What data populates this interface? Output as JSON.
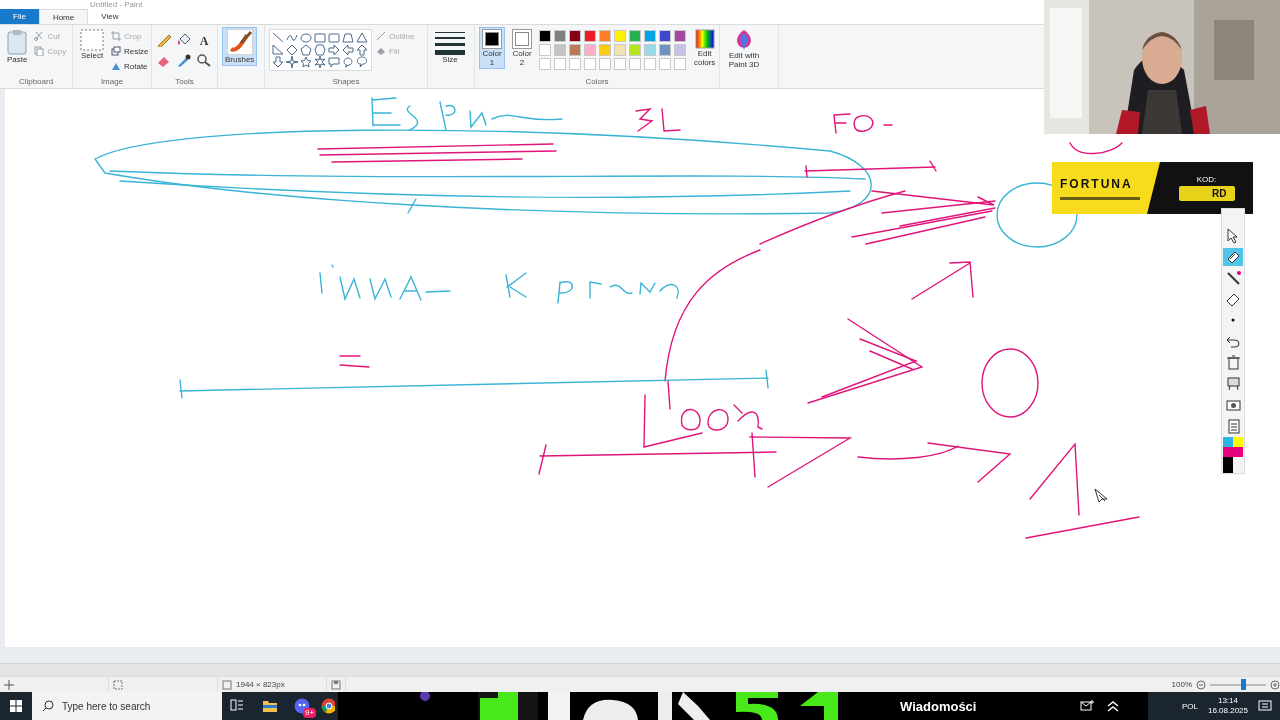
{
  "title_bar": {
    "title": "Untitled - Paint"
  },
  "tabs": [
    {
      "label": "File",
      "kind": "file",
      "selected": false
    },
    {
      "label": "Home",
      "kind": "tab",
      "selected": true
    },
    {
      "label": "View",
      "kind": "tab",
      "selected": false
    }
  ],
  "ribbon": {
    "clipboard": {
      "label": "Clipboard",
      "paste": "Paste",
      "cut": {
        "label": "Cut",
        "disabled": true
      },
      "copy": {
        "label": "Copy",
        "disabled": true
      }
    },
    "image": {
      "label": "Image",
      "select": "Select",
      "crop": {
        "label": "Crop",
        "disabled": true
      },
      "resize": {
        "label": "Resize",
        "disabled": false
      },
      "rotate": {
        "label": "Rotate",
        "disabled": false
      }
    },
    "tools": {
      "label": "Tools",
      "text_tool": "A"
    },
    "brushes": {
      "label": "Brushes",
      "selected": true
    },
    "shapes": {
      "label": "Shapes",
      "outline": {
        "label": "Outline",
        "disabled": true
      },
      "fill": {
        "label": "Fill",
        "disabled": true
      }
    },
    "size": {
      "label": "Size"
    },
    "colors": {
      "label": "Colors",
      "color1": {
        "label": "Color 1",
        "color": "#000000",
        "selected": true
      },
      "color2": {
        "label": "Color 2",
        "color": "#ffffff",
        "selected": false
      },
      "palette": [
        {
          "color": "#000000"
        },
        {
          "color": "#7f7f7f"
        },
        {
          "color": "#880015"
        },
        {
          "color": "#ed1c24"
        },
        {
          "color": "#ff7f27"
        },
        {
          "color": "#fff200"
        },
        {
          "color": "#22b14c"
        },
        {
          "color": "#00a2e8"
        },
        {
          "color": "#3f48cc"
        },
        {
          "color": "#a349a4"
        },
        {
          "color": "#ffffff"
        },
        {
          "color": "#c3c3c3"
        },
        {
          "color": "#b97a57"
        },
        {
          "color": "#ffaec9"
        },
        {
          "color": "#ffc90e"
        },
        {
          "color": "#efe4b0"
        },
        {
          "color": "#b5e61d"
        },
        {
          "color": "#99d9ea"
        },
        {
          "color": "#7092be"
        },
        {
          "color": "#c8bfe7"
        }
      ],
      "edit_colors": "Edit colors"
    },
    "paint3d": "Edit with Paint 3D"
  },
  "ad": {
    "brand": "FORTUNA",
    "code_label": "KOD:",
    "code": "RD"
  },
  "side_toolbar": {
    "tools": [
      {
        "kind": "pointer",
        "selected": false
      },
      {
        "kind": "highlighter",
        "selected": true
      },
      {
        "kind": "pen",
        "selected": false
      },
      {
        "kind": "eraser",
        "selected": false
      },
      {
        "kind": "dot",
        "selected": false
      },
      {
        "kind": "undo",
        "selected": false
      },
      {
        "kind": "trash",
        "selected": false
      },
      {
        "kind": "board",
        "selected": false
      },
      {
        "kind": "camera",
        "selected": false
      },
      {
        "kind": "clipboard",
        "selected": false
      }
    ],
    "colors": [
      {
        "color": "#29b6e0"
      },
      {
        "color": "#ffff00"
      },
      {
        "color": "#e6007e"
      },
      {
        "color": "#000000"
      }
    ]
  },
  "status_bar": {
    "canvas_size": "1944 × 823px",
    "zoom": "100%",
    "level": 0.6
  },
  "taskbar": {
    "search_placeholder": "Type here to search",
    "app_badge": "9+",
    "news": "Wiadomości",
    "language": "POL",
    "time": "13:14",
    "date": "16.08.2025"
  }
}
